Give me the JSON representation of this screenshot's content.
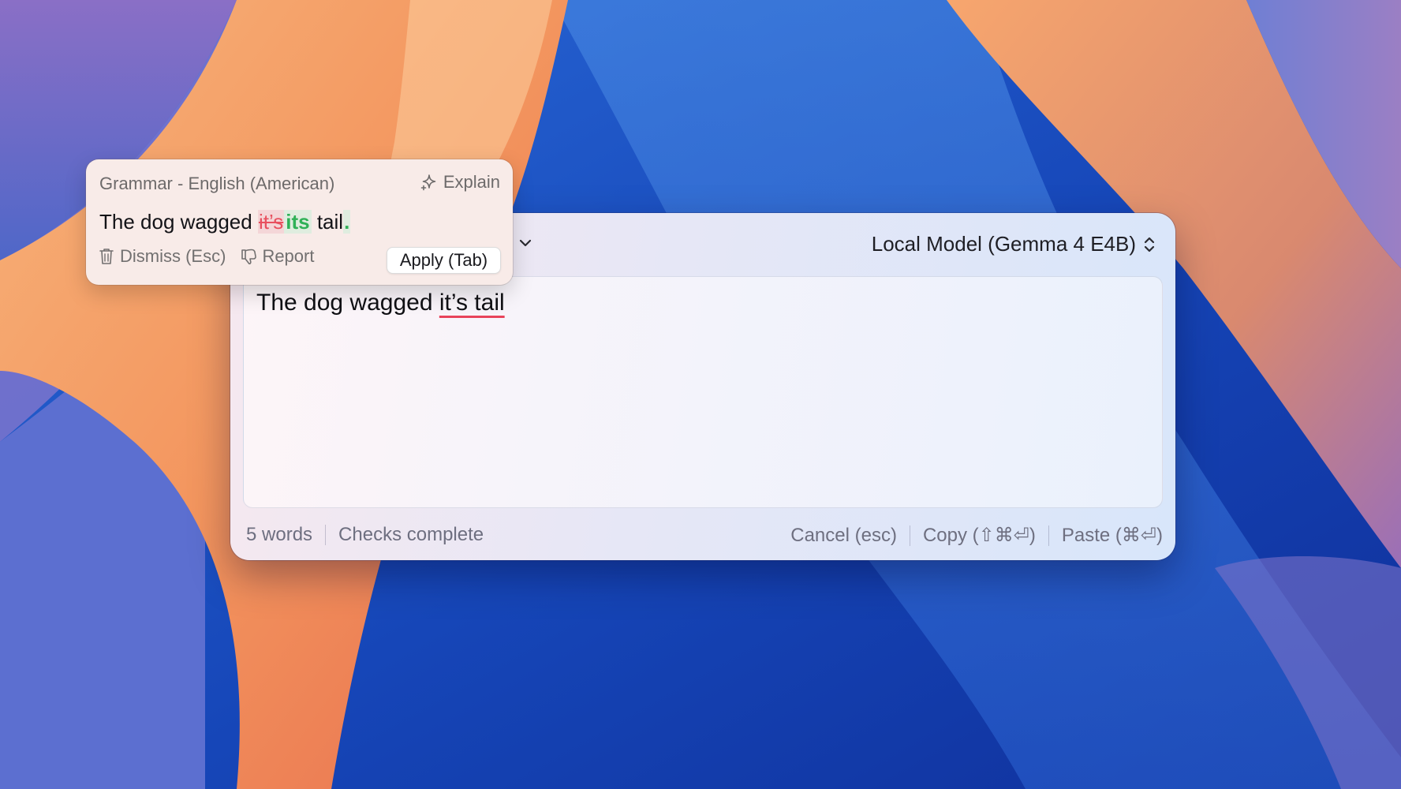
{
  "window": {
    "mode_menu_icon": "chevron-down-icon",
    "model_label": "Local Model (Gemma 4 E4B)",
    "model_menu_icon": "up-down-chevron-icon",
    "editor": {
      "text_before": "The dog wagged ",
      "error_text": "it’s tail"
    },
    "status": {
      "word_count": "5 words",
      "check_state": "Checks complete",
      "cancel": "Cancel (esc)",
      "copy": "Copy (⇧⌘⏎)",
      "paste": "Paste (⌘⏎)"
    }
  },
  "popup": {
    "title": "Grammar - English (American)",
    "explain_label": "Explain",
    "explain_icon": "sparkle-icon",
    "sentence": {
      "before": "The dog wagged ",
      "deleted": "it’s",
      "inserted": "its",
      "middle": " tail",
      "inserted_punct": "."
    },
    "dismiss_label": "Dismiss (Esc)",
    "dismiss_icon": "trash-icon",
    "report_label": "Report",
    "report_icon": "thumbs-down-icon",
    "apply_label": "Apply (Tab)"
  },
  "colors": {
    "error_underline": "#e8435a",
    "deleted_text": "#e8505f",
    "inserted_text": "#2fb157"
  }
}
